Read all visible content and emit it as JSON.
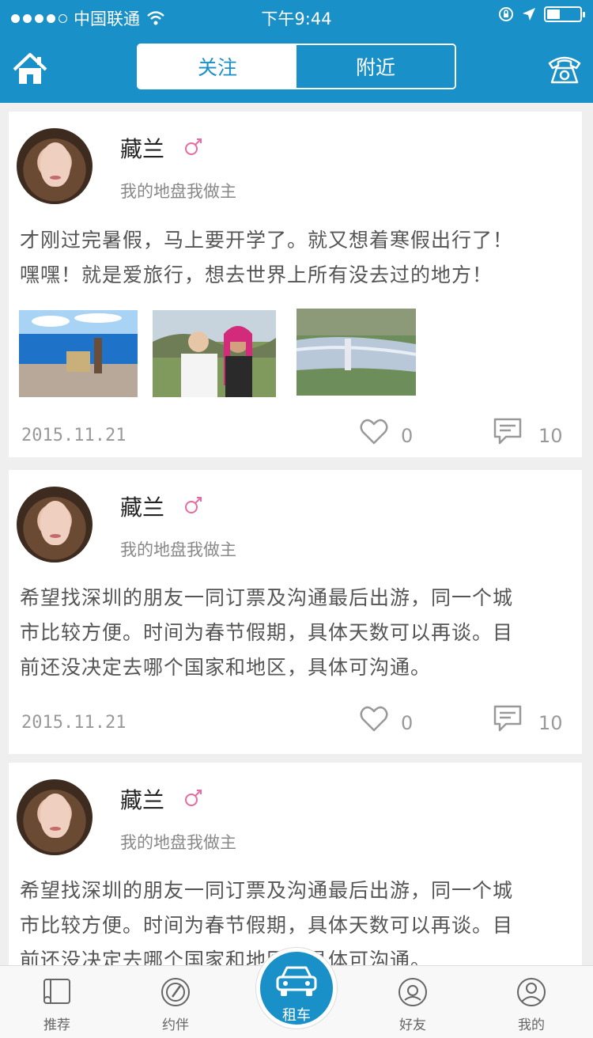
{
  "status_bar": {
    "carrier": "中国联通",
    "time": "下午9:44",
    "battery_level": 0.4
  },
  "header": {
    "home_icon": "home-icon",
    "phone_icon": "telephone-icon",
    "tabs": [
      {
        "label": "关注",
        "active": true
      },
      {
        "label": "附近",
        "active": false
      }
    ]
  },
  "posts": [
    {
      "username": "藏兰",
      "gender_icon": "female-symbol-icon",
      "signature": "我的地盘我做主",
      "content_lines": [
        "才刚过完暑假，马上要开学了。就又想着寒假出行了！",
        "嘿嘿！就是爱旅行，想去世界上所有没去过的地方！"
      ],
      "date": "2015.11.21",
      "likes": "0",
      "comments": "10",
      "images": [
        "lake-yak-photo",
        "two-women-photo",
        "river-photo"
      ]
    },
    {
      "username": "藏兰",
      "gender_icon": "female-symbol-icon",
      "signature": "我的地盘我做主",
      "content_lines": [
        "希望找深圳的朋友一同订票及沟通最后出游，同一个城",
        "市比较方便。时间为春节假期，具体天数可以再谈。目",
        "前还没决定去哪个国家和地区，具体可沟通。"
      ],
      "date": "2015.11.21",
      "likes": "0",
      "comments": "10"
    },
    {
      "username": "藏兰",
      "gender_icon": "female-symbol-icon",
      "signature": "我的地盘我做主",
      "content_lines": [
        "希望找深圳的朋友一同订票及沟通最后出游，同一个城",
        "市比较方便。时间为春节假期，具体天数可以再谈。目",
        "前还没决定去哪个国家和地区，具体可沟通。"
      ]
    }
  ],
  "tabbar": {
    "items": [
      {
        "label": "推荐",
        "icon": "book-icon"
      },
      {
        "label": "约伴",
        "icon": "compass-icon"
      },
      {
        "label": "租车",
        "icon": "car-icon"
      },
      {
        "label": "好友",
        "icon": "friends-icon"
      },
      {
        "label": "我的",
        "icon": "user-icon"
      }
    ]
  },
  "colors": {
    "brand": "#1a90c8",
    "female": "#e86aa0"
  }
}
